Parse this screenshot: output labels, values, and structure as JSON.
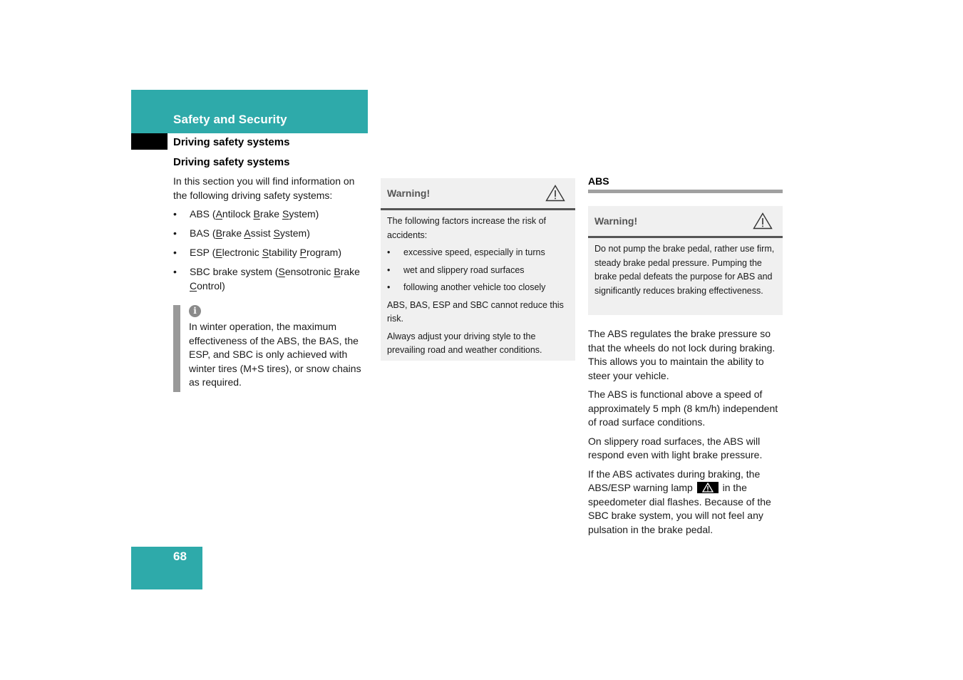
{
  "header": {
    "section_title": "Safety and Security",
    "subsection": "Driving safety systems"
  },
  "intro": {
    "heading": "Driving safety systems",
    "text": "In this section you will find information on the following driving safety systems:",
    "systems": [
      {
        "abbr": "ABS",
        "words": [
          [
            "A",
            "ntilock"
          ],
          [
            "B",
            "rake"
          ],
          [
            "S",
            "ystem"
          ]
        ]
      },
      {
        "abbr": "BAS",
        "words": [
          [
            "B",
            "rake"
          ],
          [
            "A",
            "ssist"
          ],
          [
            "S",
            "ystem"
          ]
        ]
      },
      {
        "abbr": "ESP",
        "words": [
          [
            "E",
            "lectronic"
          ],
          [
            "S",
            "tability"
          ],
          [
            "P",
            "rogram"
          ]
        ]
      },
      {
        "abbr": "SBC brake system",
        "words": [
          [
            "S",
            "ensotronic"
          ],
          [
            "B",
            "rake"
          ],
          [
            "C",
            "ontrol"
          ]
        ]
      }
    ]
  },
  "info_note": {
    "icon": "info-icon",
    "text": "In winter operation, the maximum effectiveness of the ABS, the BAS, the ESP, and SBC is only achieved with winter tires (M+S tires), or snow chains as required."
  },
  "warning_1": {
    "title": "Warning!",
    "icon": "warning-triangle-icon",
    "intro": "The following factors increase the risk of accidents:",
    "items": [
      "excessive speed, especially in turns",
      "wet and slippery road surfaces",
      "following another vehicle too closely"
    ],
    "para1": "ABS, BAS, ESP and SBC cannot reduce this risk.",
    "para2": "Always adjust your driving style to the prevailing road and weather conditions."
  },
  "abs_section": {
    "heading": "ABS",
    "warning": {
      "title": "Warning!",
      "icon": "warning-triangle-icon",
      "text": "Do not pump the brake pedal, rather use firm, steady brake pedal pressure. Pumping the brake pedal defeats the purpose for ABS and significantly reduces braking effectiveness."
    },
    "paragraphs": [
      "The ABS regulates the brake pressure so that the wheels do not lock during braking. This allows you to maintain the ability to steer your vehicle.",
      "The ABS is functional above a speed of approximately 5 mph (8 km/h) independent of road surface conditions.",
      "On slippery road surfaces, the ABS will respond even with light brake pressure."
    ],
    "lamp_para_before": "If the ABS activates during braking, the ABS/ESP warning lamp",
    "lamp_icon": "abs-esp-warning-lamp-icon",
    "lamp_para_after": "in the speedometer dial flashes. Because of the SBC brake system, you will not feel any pulsation in the brake pedal."
  },
  "page_number": "68",
  "colors": {
    "brand_teal": "#2eaaaa",
    "warning_bg": "#f0f0f0",
    "rule_gray": "#a0a0a0"
  }
}
